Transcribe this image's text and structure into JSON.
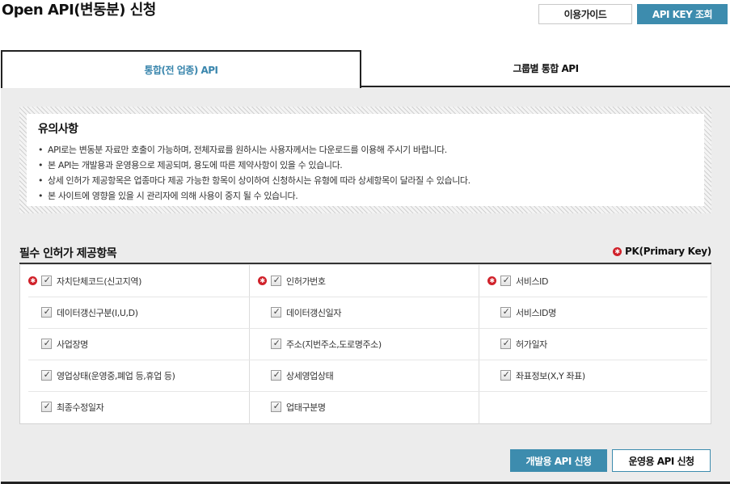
{
  "header": {
    "title": "Open API(변동분) 신청",
    "guide_button": "이용가이드",
    "apikey_button": "API KEY 조회"
  },
  "tabs": [
    {
      "label": "통합(전 업종) API",
      "active": true
    },
    {
      "label": "그룹별 통합 API",
      "active": false
    }
  ],
  "notice": {
    "title": "유의사항",
    "items": [
      "API로는 변동분 자료만 호출이 가능하며, 전체자료를 원하시는 사용자께서는 다운로드를 이용해 주시기 바랍니다.",
      "본 API는 개발용과 운영용으로 제공되며, 용도에 따른 제약사항이 있을 수 있습니다.",
      "상세 인허가 제공항목은 업종마다 제공 가능한 항목이 상이하여 신청하시는 유형에 따라 상세항목이 달라질 수 있습니다.",
      "본 사이트에 영향을 있을 시 관리자에 의해 사용이 중지 될 수 있습니다."
    ]
  },
  "fields_section": {
    "title": "필수 인허가 제공항목",
    "pk_legend": "PK(Primary Key)",
    "fields": [
      {
        "label": "자치단체코드(신고지역)",
        "pk": true,
        "checked": true
      },
      {
        "label": "인허가번호",
        "pk": true,
        "checked": true
      },
      {
        "label": "서비스ID",
        "pk": true,
        "checked": true
      },
      {
        "label": "데이터갱신구분(I,U,D)",
        "pk": false,
        "checked": true
      },
      {
        "label": "데이터갱신일자",
        "pk": false,
        "checked": true
      },
      {
        "label": "서비스ID명",
        "pk": false,
        "checked": true
      },
      {
        "label": "사업장명",
        "pk": false,
        "checked": true
      },
      {
        "label": "주소(지번주소,도로명주소)",
        "pk": false,
        "checked": true
      },
      {
        "label": "허가일자",
        "pk": false,
        "checked": true
      },
      {
        "label": "영업상태(운영중,폐업 등,휴업 등)",
        "pk": false,
        "checked": true
      },
      {
        "label": "상세영업상태",
        "pk": false,
        "checked": true
      },
      {
        "label": "좌표정보(X,Y 좌표)",
        "pk": false,
        "checked": true
      },
      {
        "label": "최종수정일자",
        "pk": false,
        "checked": true
      },
      {
        "label": "업태구분명",
        "pk": false,
        "checked": true
      }
    ]
  },
  "actions": {
    "dev_button": "개발용 API 신청",
    "ops_button": "운영용 API 신청"
  },
  "colors": {
    "accent": "#3d8cae",
    "pk_marker": "#d0212a",
    "content_bg": "#ececec"
  },
  "icons": {
    "pk_marker": "asterisk-circle-icon",
    "checkbox": "checkmark-icon"
  }
}
